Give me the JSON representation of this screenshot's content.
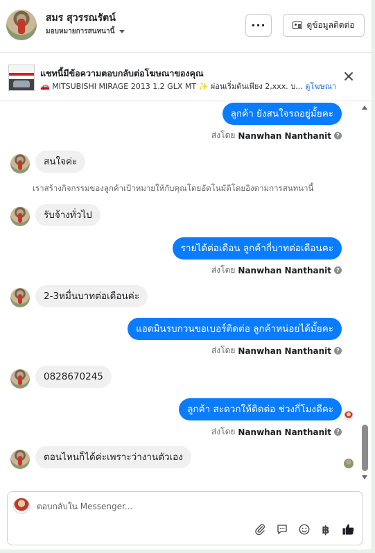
{
  "header": {
    "name": "สมร สุวรรณรัตน์",
    "subtitle": "มอบหมายการสนทนานี้",
    "more_label": "···",
    "contact_label": "ดูข้อมูลติดต่อ"
  },
  "ad": {
    "title": "แชทนี้มีข้อความตอบกลับต่อโฆษณาของคุณ",
    "description": "🚗 MITSUBISHI MIRAGE 2013 1.2 GLX MT ✨ ผ่อนเริ่มต้นเพียง 2,xxx. บ...",
    "link": "ดูโฆษณา"
  },
  "sent_by_prefix": "ส่งโดย",
  "sender": "Nanwhan Nanthanit",
  "system_note": "เราสร้างกิจกรรมของลูกค้าเป้าหมายให้กับคุณโดยอัตโนมัติโดยอิงตามการสนทนานี้",
  "messages": [
    {
      "dir": "out",
      "text": "ลูกค้า ยังสนใจรถอยู่มั้ยคะ"
    },
    {
      "dir": "in",
      "text": "สนใจค่ะ"
    },
    {
      "dir": "in",
      "text": "รับจ้างทั่วไป"
    },
    {
      "dir": "out",
      "text": "รายได้ต่อเดือน ลูกค้ากี่บาทต่อเดือนคะ"
    },
    {
      "dir": "in",
      "text": "2-3หมื่นบาทต่อเดือนค่ะ"
    },
    {
      "dir": "out",
      "text": "แอดมินรบกวนขอเบอร์ติดต่อ ลูกค้าหน่อยได้มั้ยคะ"
    },
    {
      "dir": "in",
      "text": "0828670245"
    },
    {
      "dir": "out",
      "text": "ลูกค้า สะดวกให้ติดต่อ ช่วงกี่โมงดีคะ"
    },
    {
      "dir": "in",
      "text": "ตอนไหนก็ได้ค่ะเพราะว่างานตัวเอง"
    }
  ],
  "composer": {
    "placeholder": "ตอบกลับใน Messenger..."
  },
  "icons": [
    "more-icon",
    "contact-card-icon",
    "close-icon",
    "info-icon",
    "paperclip-icon",
    "chat-bubble-icon",
    "emoji-icon",
    "baht-icon",
    "thumbs-up-icon"
  ],
  "colors": {
    "outgoing": "#0a7cff",
    "incoming": "#f0f0f0",
    "link": "#1a6ed8"
  }
}
